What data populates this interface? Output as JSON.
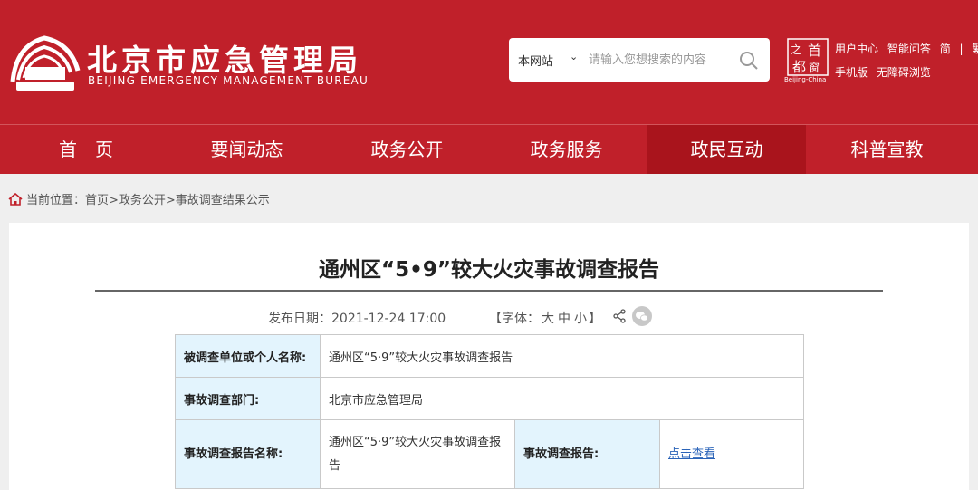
{
  "header": {
    "title": "北京市应急管理局",
    "subtitle": "BEIJING  EMERGENCY MANAGEMENT BUREAU",
    "brand_color": "#c0202a",
    "logo_icon": "beijing-emergency-logo-icon"
  },
  "search": {
    "scope": "本网站",
    "placeholder": "请输入您想搜索的内容",
    "icon": "search-icon"
  },
  "capital_logo": {
    "chars": [
      "首",
      "都",
      "之",
      "窗"
    ],
    "label": "Beijing-China"
  },
  "top_links": {
    "user_center": "用户中心",
    "smart_qa": "智能问答",
    "simplified": "简",
    "separator": "|",
    "traditional": "繁",
    "mobile": "手机版",
    "accessible": "无障碍浏览"
  },
  "nav": {
    "active_color": "#a9141c",
    "items": [
      {
        "label": "首　页"
      },
      {
        "label": "要闻动态"
      },
      {
        "label": "政务公开"
      },
      {
        "label": "政务服务"
      },
      {
        "label": "政民互动"
      },
      {
        "label": "科普宣教"
      }
    ],
    "active_index": 4
  },
  "breadcrumb": {
    "prefix": "当前位置：",
    "path": "首页>政务公开>事故调查结果公示"
  },
  "article": {
    "title": "通州区“5•9”较大火灾事故调查报告",
    "date_label": "发布日期：",
    "date": "2021-12-24 17:00",
    "font_label_open": "【字体：",
    "font_large": "大",
    "font_medium": "中",
    "font_small": "小",
    "font_label_close": "】"
  },
  "info_table": {
    "row1_label": "被调查单位或个人名称:",
    "row1_value": "通州区“5·9”较大火灾事故调查报告",
    "row2_label": "事故调查部门:",
    "row2_value": "北京市应急管理局",
    "row3_label": "事故调查报告名称:",
    "row3_value": "通州区“5·9”较大火灾事故调查报告",
    "row3_label2": "事故调查报告:",
    "row3_link": "点击查看",
    "label_bg": "#e3f4fd",
    "link_color": "#2a63b8"
  }
}
